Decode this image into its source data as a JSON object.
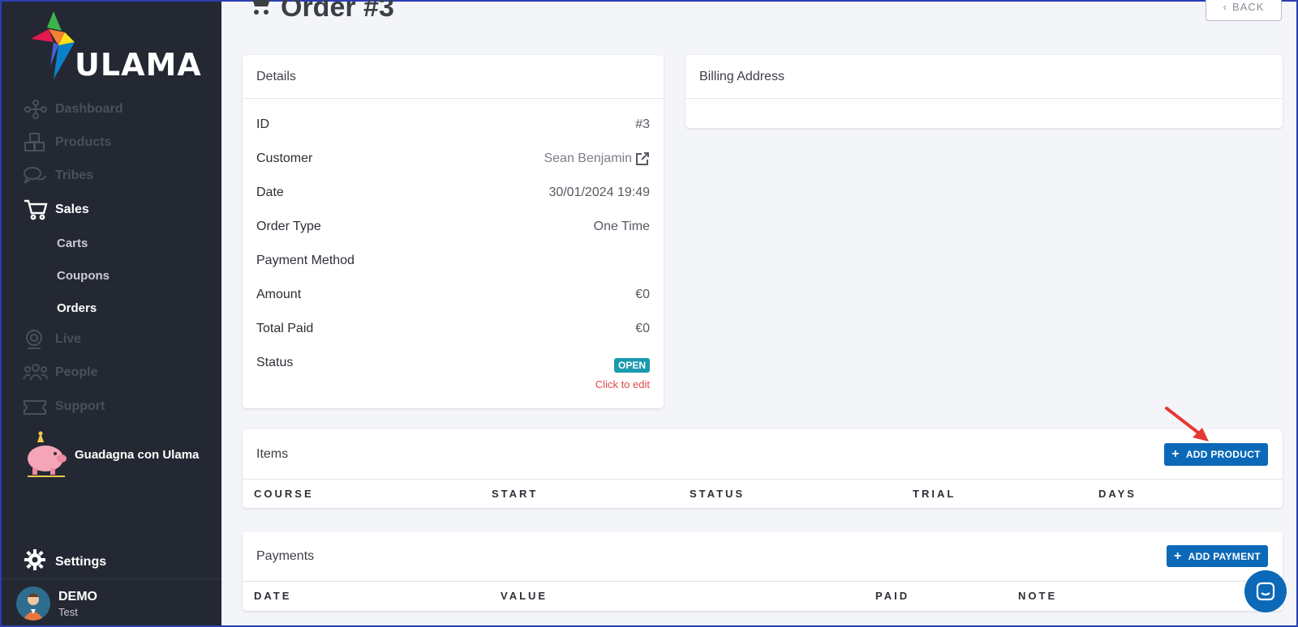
{
  "brand": {
    "name": "ULAMA"
  },
  "sidebar": {
    "nav": [
      {
        "label": "Dashboard",
        "icon": "network-icon"
      },
      {
        "label": "Products",
        "icon": "boxes-icon"
      },
      {
        "label": "Tribes",
        "icon": "chat-bubbles-icon"
      },
      {
        "label": "Sales",
        "icon": "cart-icon"
      },
      {
        "label": "Live",
        "icon": "webcam-icon"
      },
      {
        "label": "People",
        "icon": "people-icon"
      },
      {
        "label": "Support",
        "icon": "ticket-icon"
      }
    ],
    "sales_sub": [
      {
        "label": "Carts"
      },
      {
        "label": "Coupons"
      },
      {
        "label": "Orders"
      }
    ],
    "promo_label": "Guadagna con Ulama",
    "settings_label": "Settings",
    "user": {
      "name": "DEMO",
      "role": "Test"
    }
  },
  "header": {
    "title": "Order #3",
    "back_label": "BACK"
  },
  "details": {
    "title": "Details",
    "rows": [
      {
        "label": "ID",
        "value": "#3"
      },
      {
        "label": "Customer",
        "value": "Sean Benjamin"
      },
      {
        "label": "Date",
        "value": "30/01/2024 19:49"
      },
      {
        "label": "Order Type",
        "value": "One Time"
      },
      {
        "label": "Payment Method",
        "value": ""
      },
      {
        "label": "Amount",
        "value": "€0"
      },
      {
        "label": "Total Paid",
        "value": "€0"
      },
      {
        "label": "Status",
        "value": "OPEN"
      }
    ],
    "edit_label": "Click to edit"
  },
  "billing": {
    "title": "Billing Address"
  },
  "items": {
    "title": "Items",
    "add_label": "ADD PRODUCT",
    "columns": [
      "COURSE",
      "START",
      "STATUS",
      "TRIAL",
      "DAYS"
    ]
  },
  "payments": {
    "title": "Payments",
    "add_label": "ADD PAYMENT",
    "columns": [
      "DATE",
      "VALUE",
      "PAID",
      "NOTE"
    ]
  },
  "colors": {
    "sidebar_bg": "#242833",
    "primary": "#0b69b8",
    "badge": "#1a9aad",
    "danger": "#e04848"
  }
}
